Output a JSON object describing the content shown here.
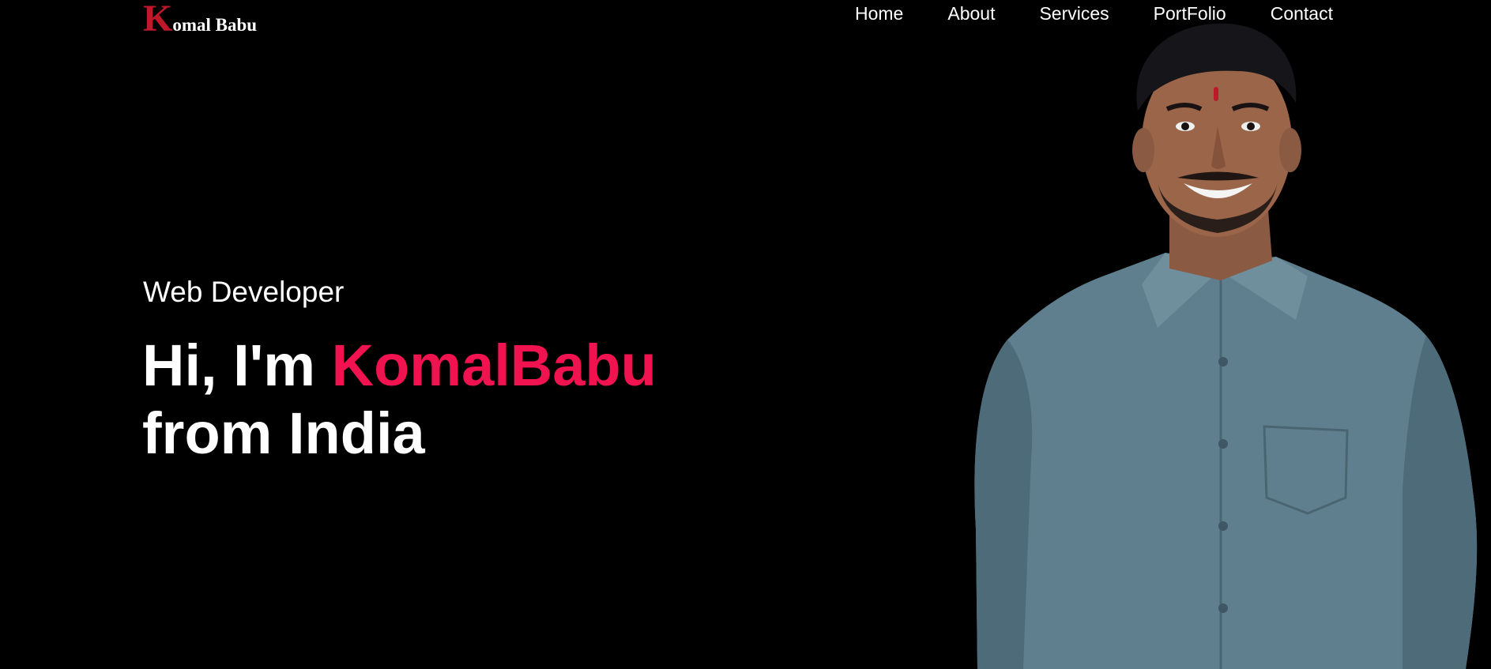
{
  "logo": {
    "initial": "K",
    "rest": "omal Babu"
  },
  "nav": {
    "items": [
      "Home",
      "About",
      "Services",
      "PortFolio",
      "Contact"
    ]
  },
  "hero": {
    "subtitle": "Web Developer",
    "greeting": "Hi, I'm ",
    "name": "KomalBabu",
    "origin": "from India"
  },
  "colors": {
    "background": "#000000",
    "accent": "#f0134f",
    "logo_initial": "#c0182b",
    "text": "#ffffff",
    "shirt": "#5f7f8e"
  },
  "icons": {
    "portrait": "person-photo"
  }
}
